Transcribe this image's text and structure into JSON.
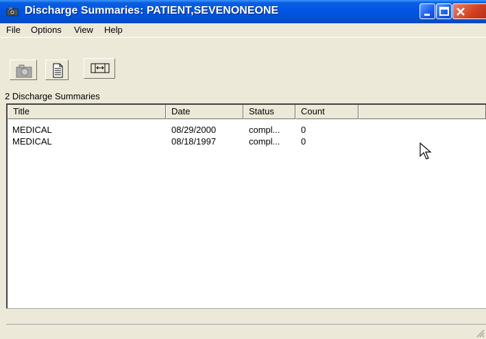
{
  "window": {
    "title": "Discharge Summaries: PATIENT,SEVENONEONE"
  },
  "menu": {
    "items": [
      "File",
      "Options",
      "View",
      "Help"
    ]
  },
  "toolbar": {
    "buttons": [
      "camera-icon",
      "document-icon",
      "column-width-icon"
    ]
  },
  "summary_count_label": "2  Discharge Summaries",
  "table": {
    "columns": [
      "Title",
      "Date",
      "Status",
      "Count"
    ],
    "rows": [
      {
        "title": "MEDICAL",
        "date": "08/29/2000",
        "status": "compl...",
        "count": "0"
      },
      {
        "title": "MEDICAL",
        "date": "08/18/1997",
        "status": "compl...",
        "count": "0"
      }
    ]
  },
  "colors": {
    "titlebar": "#0054e3",
    "face": "#ece9d8",
    "list_background": "#ffffff"
  }
}
